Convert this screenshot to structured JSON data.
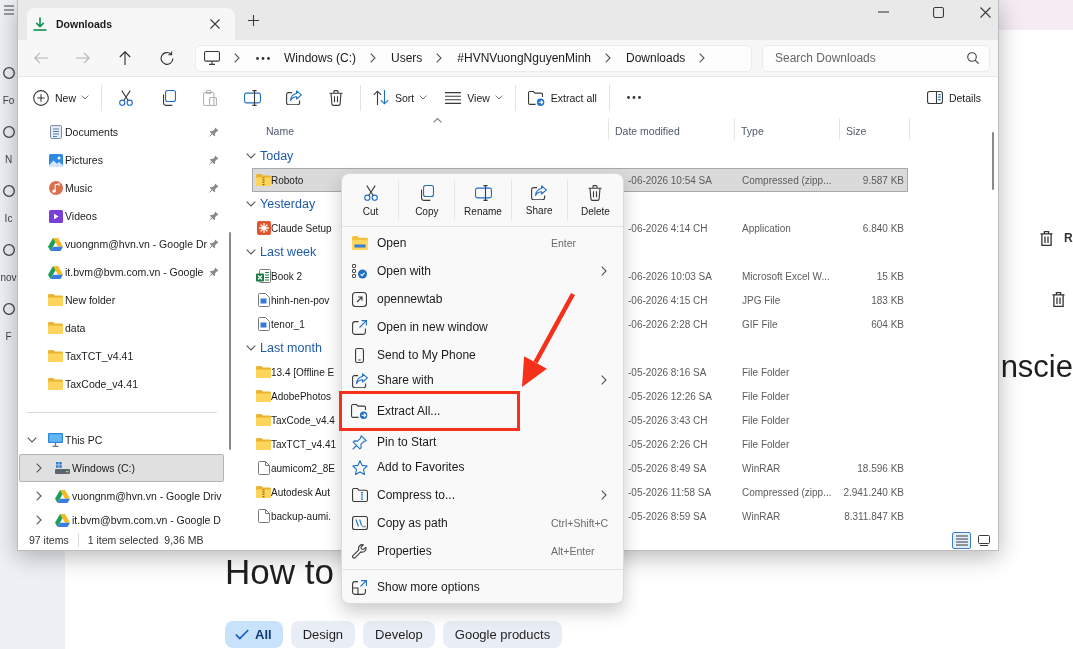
{
  "page": {
    "nav_rail": [
      {
        "label": "Fo"
      },
      {
        "label": "N"
      },
      {
        "label": "Ic"
      },
      {
        "label": "nov"
      },
      {
        "label": "F"
      }
    ],
    "side_actions": [
      {
        "kind": "labelled",
        "label": "R"
      },
      {
        "kind": "icon"
      }
    ],
    "heading": "nscie",
    "title": "How to",
    "filters": [
      {
        "label": "All",
        "selected": true
      },
      {
        "label": "Design",
        "selected": false
      },
      {
        "label": "Develop",
        "selected": false
      },
      {
        "label": "Google products",
        "selected": false
      }
    ]
  },
  "explorer": {
    "tabs": [
      {
        "title": "Downloads",
        "selected": true
      }
    ],
    "nav_buttons": [
      {
        "kind": "back",
        "disabled": true
      },
      {
        "kind": "forward",
        "disabled": true
      },
      {
        "kind": "up",
        "disabled": false
      },
      {
        "kind": "refresh",
        "disabled": false
      }
    ],
    "breadcrumb": [
      "Windows (C:)",
      "Users",
      "#HVNVuongNguyenMinh",
      "Downloads"
    ],
    "search": {
      "placeholder": "Search Downloads"
    },
    "toolbar": {
      "groups": [
        {
          "items": [
            {
              "kind": "new",
              "label": "New",
              "dropdown": true
            }
          ]
        },
        {
          "items": [
            {
              "kind": "cut",
              "disabled": false
            },
            {
              "kind": "copy",
              "disabled": false
            },
            {
              "kind": "paste",
              "disabled": true
            },
            {
              "kind": "rename",
              "disabled": false
            },
            {
              "kind": "share",
              "disabled": false
            },
            {
              "kind": "delete",
              "disabled": false
            }
          ]
        },
        {
          "items": [
            {
              "kind": "sort",
              "label": "Sort",
              "dropdown": true
            },
            {
              "kind": "view",
              "label": "View",
              "dropdown": true
            }
          ]
        },
        {
          "items": [
            {
              "kind": "extract",
              "label": "Extract all",
              "dropdown": false
            }
          ]
        },
        {
          "items": [
            {
              "kind": "more"
            }
          ]
        }
      ],
      "details": {
        "label": "Details"
      }
    },
    "sidebar": {
      "sections": [
        {
          "items": [
            {
              "kind": "documents",
              "label": "Documents",
              "pinned": true,
              "selected": false
            },
            {
              "kind": "pictures",
              "label": "Pictures",
              "pinned": true,
              "selected": false
            },
            {
              "kind": "music",
              "label": "Music",
              "pinned": true,
              "selected": false
            },
            {
              "kind": "videos",
              "label": "Videos",
              "pinned": true,
              "selected": false
            },
            {
              "kind": "cloud",
              "label": "vuongnm@hvn.vn - Google Dr",
              "pinned": true,
              "selected": false
            },
            {
              "kind": "cloud",
              "label": "it.bvm@bvm.com.vn - Google",
              "pinned": true,
              "selected": false
            },
            {
              "kind": "folder",
              "label": "New folder",
              "pinned": false,
              "selected": false
            },
            {
              "kind": "folder",
              "label": "data",
              "pinned": false,
              "selected": false
            },
            {
              "kind": "folder",
              "label": "TaxTCT_v4.41",
              "pinned": false,
              "selected": false
            },
            {
              "kind": "folder",
              "label": "TaxCode_v4.41",
              "pinned": false,
              "selected": false
            }
          ]
        },
        {
          "items": [
            {
              "kind": "pc",
              "label": "This PC",
              "expanded": true,
              "selected": false,
              "children": [
                {
                  "kind": "drive",
                  "label": "Windows (C:)",
                  "expanded": false,
                  "selected": true
                },
                {
                  "kind": "cloud",
                  "label": "vuongnm@hvn.vn - Google Driv",
                  "expanded": false,
                  "selected": false
                },
                {
                  "kind": "cloud",
                  "label": "it.bvm@bvm.com.vn - Google D",
                  "expanded": false,
                  "selected": false
                }
              ]
            }
          ]
        }
      ]
    },
    "file_list": {
      "columns": [
        {
          "label": "Name",
          "sorted": true
        },
        {
          "label": "Date modified",
          "sorted": false
        },
        {
          "label": "Type",
          "sorted": false
        },
        {
          "label": "Size",
          "sorted": false
        }
      ],
      "groups": [
        {
          "label": "Today",
          "expanded": true,
          "rows": [
            {
              "kind": "zip",
              "name": "Roboto",
              "date": "-06-2026 10:54 SA",
              "type": "Compressed (zipp...",
              "size": "9.587 KB",
              "selected": true
            }
          ]
        },
        {
          "label": "Yesterday",
          "expanded": true,
          "rows": [
            {
              "kind": "app",
              "name": "Claude Setup",
              "date": "-06-2026 4:14 CH",
              "type": "Application",
              "size": "6.840 KB",
              "selected": false
            }
          ]
        },
        {
          "label": "Last week",
          "expanded": true,
          "rows": [
            {
              "kind": "excel",
              "name": "Book 2",
              "date": "-06-2026 10:03 SA",
              "type": "Microsoft Excel W...",
              "size": "15 KB",
              "selected": false
            },
            {
              "kind": "image",
              "name": "hinh-nen-pov",
              "date": "-06-2026 4:15 CH",
              "type": "JPG File",
              "size": "183 KB",
              "selected": false
            },
            {
              "kind": "image",
              "name": "tenor_1",
              "date": "-06-2026 2:28 CH",
              "type": "GIF File",
              "size": "604 KB",
              "selected": false
            }
          ]
        },
        {
          "label": "Last month",
          "expanded": true,
          "rows": [
            {
              "kind": "folder",
              "name": "13.4 [Offline E",
              "date": "-05-2026 8:16 SA",
              "type": "File Folder",
              "selected": false
            },
            {
              "kind": "folder",
              "name": "AdobePhotos",
              "date": "-05-2026 12:26 SA",
              "type": "File Folder",
              "selected": false
            },
            {
              "kind": "folder",
              "name": "TaxCode_v4.4",
              "date": "-05-2026 3:43 CH",
              "type": "File Folder",
              "selected": false
            },
            {
              "kind": "folder",
              "name": "TaxTCT_v4.41",
              "date": "-05-2026 2:26 CH",
              "type": "File Folder",
              "selected": false
            },
            {
              "kind": "file",
              "name": "aumicom2_8E",
              "date": "-05-2026 8:49 SA",
              "type": "WinRAR",
              "size": "18.596 KB",
              "selected": false
            },
            {
              "kind": "zip",
              "name": "Autodesk Aut",
              "date": "-05-2026 11:58 SA",
              "type": "Compressed (zipp...",
              "size": "2.941.240 KB",
              "selected": false
            },
            {
              "kind": "file",
              "name": "backup-aumi.",
              "date": "-05-2026 8:59 SA",
              "type": "WinRAR",
              "size": "8.311.847 KB",
              "selected": false
            }
          ]
        }
      ]
    },
    "status_bar": {
      "count": "97 items",
      "selection": "1 item selected",
      "selection_size": "9,36 MB",
      "views": [
        {
          "kind": "details",
          "selected": true
        },
        {
          "kind": "tiles",
          "selected": false
        }
      ]
    }
  },
  "context_menu": {
    "actions": [
      {
        "kind": "cut",
        "label": "Cut"
      },
      {
        "kind": "copy",
        "label": "Copy"
      },
      {
        "kind": "rename",
        "label": "Rename"
      },
      {
        "kind": "share",
        "label": "Share"
      },
      {
        "kind": "delete",
        "label": "Delete"
      }
    ],
    "items": [
      {
        "kind": "open",
        "label": "Open",
        "shortcut": "Enter",
        "submenu": false,
        "highlighted": false
      },
      {
        "kind": "open-with",
        "label": "Open with",
        "submenu": true,
        "highlighted": false
      },
      {
        "kind": "new-tab",
        "label": "opennewtab",
        "submenu": false,
        "highlighted": false
      },
      {
        "kind": "new-window",
        "label": "Open in new window",
        "submenu": false,
        "highlighted": false
      },
      {
        "kind": "phone",
        "label": "Send to My Phone",
        "submenu": false,
        "highlighted": false
      },
      {
        "kind": "share",
        "label": "Share with",
        "submenu": true,
        "highlighted": false
      },
      {
        "kind": "extract",
        "label": "Extract All...",
        "submenu": false,
        "highlighted": true
      },
      {
        "kind": "pin",
        "label": "Pin to Start",
        "submenu": false,
        "highlighted": false
      },
      {
        "kind": "star",
        "label": "Add to Favorites",
        "submenu": false,
        "highlighted": false
      },
      {
        "kind": "compress",
        "label": "Compress to...",
        "submenu": true,
        "highlighted": false
      },
      {
        "kind": "copy-path",
        "label": "Copy as path",
        "shortcut": "Ctrl+Shift+C",
        "submenu": false,
        "highlighted": false
      },
      {
        "kind": "properties",
        "label": "Properties",
        "shortcut": "Alt+Enter",
        "submenu": false,
        "highlighted": false
      }
    ],
    "footer": [
      {
        "kind": "more-options",
        "label": "Show more options",
        "submenu": false,
        "highlighted": false
      }
    ]
  }
}
